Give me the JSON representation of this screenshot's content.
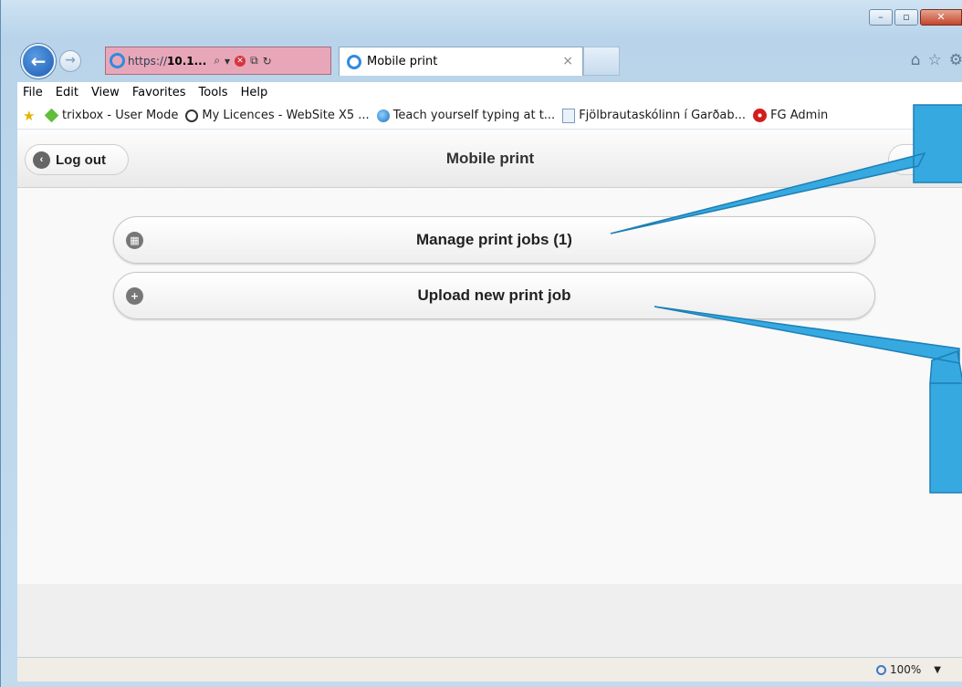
{
  "browser": {
    "address_prefix": "https://",
    "address_host": "10.1...",
    "tab_title": "Mobile print",
    "menu": [
      "File",
      "Edit",
      "View",
      "Favorites",
      "Tools",
      "Help"
    ],
    "favorites": [
      {
        "label": "trixbox - User Mode",
        "icon": "diamond-icon"
      },
      {
        "label": "My Licences - WebSite X5 ...",
        "icon": "circle-icon"
      },
      {
        "label": "Teach yourself typing at t...",
        "icon": "globe-icon"
      },
      {
        "label": "Fjölbrautaskólinn í Garðab...",
        "icon": "ie-page-icon"
      },
      {
        "label": "FG Admin",
        "icon": "gear-icon"
      }
    ],
    "zoom": "100%"
  },
  "page": {
    "logout_label": "Log out",
    "title": "Mobile print",
    "items": [
      {
        "label": "Manage print jobs (1)",
        "icon": "grid-icon"
      },
      {
        "label": "Upload new print job",
        "icon": "plus-icon"
      }
    ]
  },
  "colors": {
    "address_highlight": "#e8a7b9",
    "callout": "#36a9e1"
  }
}
